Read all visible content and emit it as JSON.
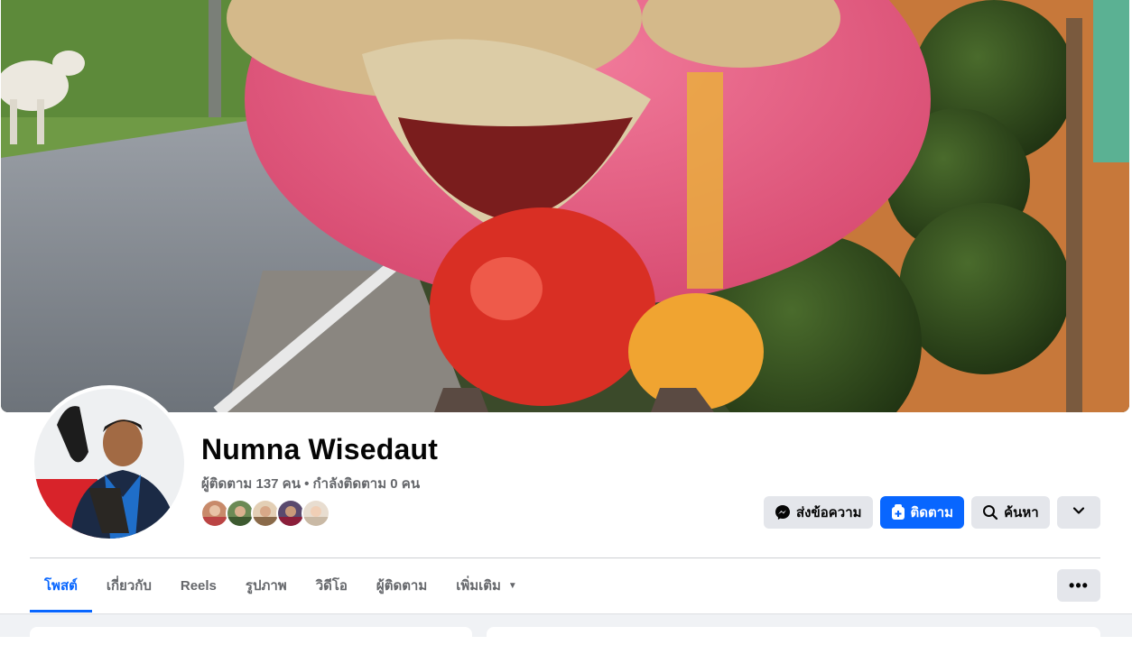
{
  "profile": {
    "name": "Numna Wisedaut",
    "stats": "ผู้ติดตาม 137 คน • กำลังติดตาม 0 คน"
  },
  "actions": {
    "message_label": "ส่งข้อความ",
    "follow_label": "ติดตาม",
    "search_label": "ค้นหา"
  },
  "tabs": [
    {
      "label": "โพสต์"
    },
    {
      "label": "เกี่ยวกับ"
    },
    {
      "label": "Reels"
    },
    {
      "label": "รูปภาพ"
    },
    {
      "label": "วิดีโอ"
    },
    {
      "label": "ผู้ติดตาม"
    },
    {
      "label": "เพิ่มเติม"
    }
  ],
  "more_menu_label": "•••",
  "colors": {
    "accent": "#0866ff",
    "secondary_text": "#65676b",
    "button_grey": "#e4e6eb"
  },
  "icons": {
    "message": "messenger-icon",
    "follow": "follow-icon",
    "search": "search-icon",
    "dropdown": "chevron-down-icon",
    "more": "ellipsis-icon"
  }
}
